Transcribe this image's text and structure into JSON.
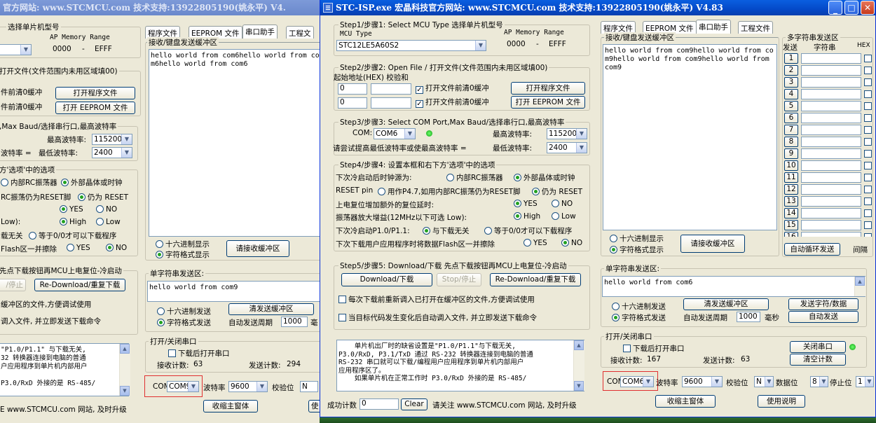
{
  "background_window": {
    "title": "官方网站: www.STCMCU.com  技术支持:13922805190(姚永平)  V4.",
    "step1": {
      "label": "选择单片机型号",
      "ap_label": "AP Memory Range",
      "ap_start": "0000",
      "ap_dash": "-",
      "ap_end": "EFFF"
    },
    "step2": {
      "title": "打开文件(文件范围内未用区域填00)",
      "row1": "件前清0缓冲",
      "row2": "件前清0缓冲",
      "btn_open": "打开程序文件",
      "btn_eeprom": "打开 EEPROM 文件"
    },
    "step3": {
      "title": ",Max Baud/选择串行口,最高波特率",
      "max_label": "最高波特率:",
      "max_val": "115200",
      "min_prefix": "波特率 =",
      "min_label": "最低波特率:",
      "min_val": "2400"
    },
    "step4": {
      "title": "方'选项'中的选项",
      "r1a": "内部RC振荡器",
      "r1b": "外部晶体或时钟",
      "r2a": "RC振荡仍为RESET脚",
      "r2b": "仍为 RESET",
      "yes": "YES",
      "no": "NO",
      "low_prefix": "Low):",
      "high": "High",
      "low": "Low",
      "r5a": "载无关",
      "r5b": "等于0/0才可以下载程序",
      "r6a": "Flash区一并擦除",
      "r6b": "YES",
      "r6c": "NO"
    },
    "step5": {
      "title": "先点下载按钮再MCU上电复位-冷启动",
      "btn_stop": "/停止",
      "btn_redl": "Re-Download/重复下载",
      "opt1": "缓冲区的文件,方便调试使用",
      "opt2": "调入文件, 并立即发送下载命令"
    },
    "info": "\"P1.0/P1.1\" 与下载无关,\n32 转换器连接到电脑的普通\n户应用程序到单片机内部用户\n\nP3.0/RxD 外接的是 RS-485/",
    "footer": "E www.STCMCU.com 网站, 及时升级",
    "tabs": [
      "程序文件",
      "EEPROM 文件",
      "串口助手",
      "工程文"
    ],
    "recv_label": "接收/键盘发送缓冲区",
    "recv_text": "hello world from com6hello world from com6hello world from com6",
    "hex_display": "十六进制显示",
    "char_display": "字符格式显示",
    "clear_recv": "请接收缓冲区",
    "single_label": "单字符串发送区:",
    "single_text": "hello world from com9",
    "hex_send": "十六进制发送",
    "char_send": "字符格式发送",
    "clear_send": "清发送缓冲区",
    "auto_period": "自动发送周期",
    "period_val": "1000",
    "period_unit": "毫",
    "port_group": "打开/关闭串口",
    "open_on_dl": "下载后打开串口",
    "recv_count_label": "接收计数:",
    "recv_count": "63",
    "send_count_label": "发送计数:",
    "send_count": "294",
    "com_label": "COM",
    "com_val": "COM9",
    "baud_label": "波特率",
    "baud_val": "9600",
    "parity_label": "校验位",
    "parity_val": "N",
    "collapse": "收缩主窗体",
    "use": "使"
  },
  "main_window": {
    "title": "STC-ISP.exe    宏晶科技官方网站: www.STCMCU.com  技术支持:13922805190(姚永平)  V4.83",
    "step1": {
      "title": "Step1/步骤1: Select MCU Type  选择单片机型号",
      "mcu_type": "MCU Type",
      "mcu_val": "STC12LE5A60S2",
      "ap_label": "AP Memory Range",
      "ap_start": "0000",
      "ap_dash": "-",
      "ap_end": "EFFF"
    },
    "step2": {
      "title": "Step2/步骤2: Open File / 打开文件(文件范围内未用区域填00)",
      "start_label": "起始地址(HEX) 校验和",
      "addr1": "0",
      "addr2": "0",
      "chk1": "打开文件前清0缓冲",
      "chk2": "打开文件前清0缓冲",
      "btn_open": "打开程序文件",
      "btn_eeprom": "打开 EEPROM 文件"
    },
    "step3": {
      "title": "Step3/步骤3: Select COM Port,Max Baud/选择串行口,最高波特率",
      "com_label": "COM:",
      "com_val": "COM6",
      "max_label": "最高波特率:",
      "max_val": "115200",
      "hint": "请尝试提高最低波特率或使最高波特率 =",
      "min_label": "最低波特率:",
      "min_val": "2400"
    },
    "step4": {
      "title": "Step4/步骤4: 设置本框和右下方'选项'中的选项",
      "r1": "下次冷启动后时钟源为:",
      "r1a": "内部RC振荡器",
      "r1b": "外部晶体或时钟",
      "r2": "RESET pin",
      "r2a": "用作P4.7,如用内部RC振荡仍为RESET脚",
      "r2b": "仍为 RESET",
      "r3": "上电复位增加额外的复位延时:",
      "r3a": "YES",
      "r3b": "NO",
      "r4": "振荡器放大增益(12MHz以下可选 Low):",
      "r4a": "High",
      "r4b": "Low",
      "r5": "下次冷启动P1.0/P1.1:",
      "r5a": "与下载无关",
      "r5b": "等于0/0才可以下载程序",
      "r6": "下次下载用户应用程序时将数据Flash区一并擦除",
      "r6a": "YES",
      "r6b": "NO"
    },
    "step5": {
      "title": "Step5/步骤5: Download/下载  先点下载按钮再MCU上电复位-冷启动",
      "btn_dl": "Download/下载",
      "btn_stop": "Stop/停止",
      "btn_redl": "Re-Download/重复下载",
      "opt1": "每次下载前重新调入已打开在缓冲区的文件,方便调试使用",
      "opt2": "当目标代码发生变化后自动调入文件, 并立即发送下载命令"
    },
    "info": "    单片机出厂时的缺省设置是\"P1.0/P1.1\"与下载无关,\nP3.0/RxD, P3.1/TxD 通过 RS-232 转换器连接到电脑的普通\nRS-232 串口就可以下载/编程用户应用程序到单片机内部用户\n应用程序区了。\n    如果单片机在正常工作时 P3.0/RxD 外接的是 RS-485/",
    "success_label": "成功计数",
    "success_val": "0",
    "clear": "Clear",
    "footer": "请关注 www.STCMCU.com 网站, 及时升级"
  },
  "assistant": {
    "tabs": [
      "程序文件",
      "EEPROM 文件",
      "串口助手",
      "工程文件"
    ],
    "recv_label": "接收/键盘发送缓冲区",
    "recv_text": "hello world from com9hello world from com9hello world from com9hello world from com9",
    "hex_display": "十六进制显示",
    "char_display": "字符格式显示",
    "clear_recv": "请接收缓冲区",
    "multi": {
      "title": "多字符串发送区",
      "h_send": "发送",
      "h_str": "字符串",
      "h_hex": "HEX",
      "rows": [
        "1",
        "2",
        "3",
        "4",
        "5",
        "6",
        "7",
        "8",
        "9",
        "10",
        "11",
        "12",
        "13",
        "14",
        "15",
        "16"
      ],
      "auto_cycle": "自动循环发送",
      "interval": "间隔"
    },
    "single_label": "单字符串发送区:",
    "single_text": "hello world from com6",
    "hex_send": "十六进制发送",
    "char_send": "字符格式发送",
    "clear_send": "清发送缓冲区",
    "send_data": "发送字符/数据",
    "auto_send": "自动发送",
    "auto_period": "自动发送周期",
    "period_val": "1000",
    "period_unit": "毫秒",
    "port_group": "打开/关闭串口",
    "open_on_dl": "下载后打开串口",
    "close_port": "关闭串口",
    "recv_count_label": "接收计数:",
    "recv_count": "167",
    "send_count_label": "发送计数:",
    "send_count": "63",
    "clear_count": "清空计数",
    "com_label": "COM",
    "com_val": "COM6",
    "baud_label": "波特率",
    "baud_val": "9600",
    "parity_label": "校验位",
    "parity_val": "N",
    "data_label": "数据位",
    "data_val": "8",
    "stop_label": "停止位",
    "stop_val": "1",
    "collapse": "收缩主窗体",
    "help": "使用说明"
  }
}
